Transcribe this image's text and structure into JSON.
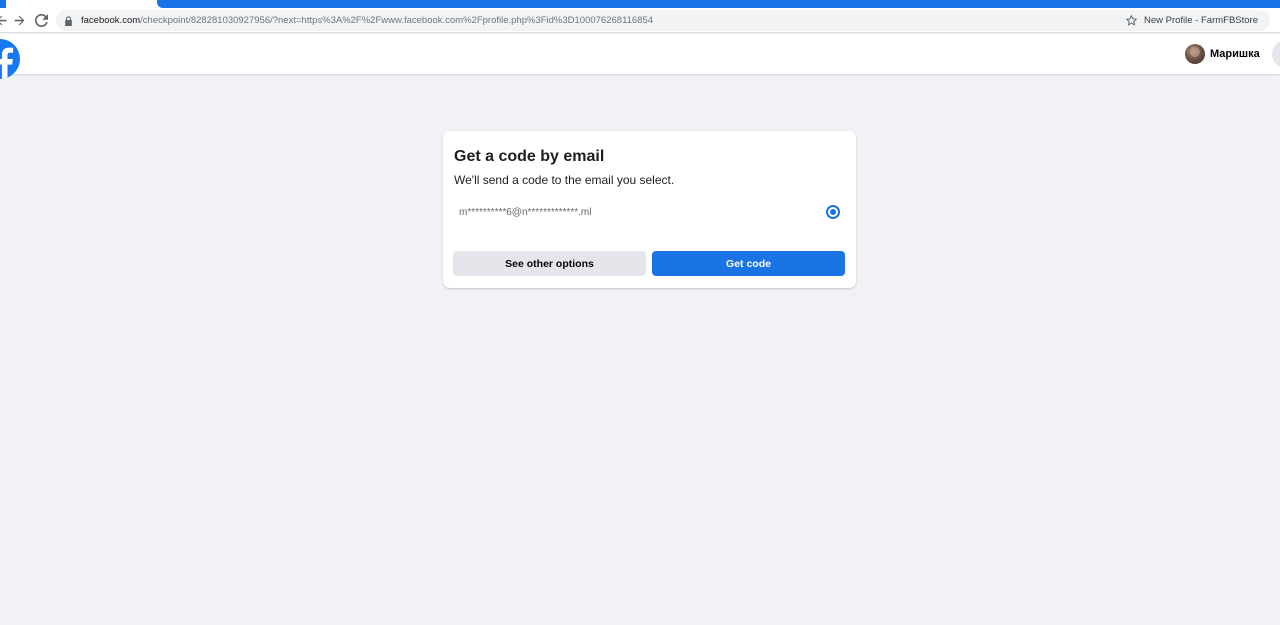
{
  "browser": {
    "url_host": "facebook.com",
    "url_path": "/checkpoint/828281030927956/?next=https%3A%2F%2Fwww.facebook.com%2Fprofile.php%3Fid%3D100076268116854",
    "profile_label": "New Profile - FarmFBStore"
  },
  "header": {
    "account_name": "Маришка"
  },
  "card": {
    "title": "Get a code by email",
    "subtitle": "We'll send a code to the email you select.",
    "email_option": "m**********6@n*************.ml",
    "secondary_button": "See other options",
    "primary_button": "Get code"
  },
  "colors": {
    "brand": "#1877f2",
    "primary_button": "#1b74e4",
    "secondary_button": "#e4e6eb",
    "page_background": "#f0f2f5"
  },
  "icons": {
    "back": "arrow-left-icon",
    "forward": "arrow-right-icon",
    "reload": "reload-icon",
    "lock": "lock-icon",
    "bookmark": "star-icon",
    "logo": "facebook-logo-icon"
  }
}
